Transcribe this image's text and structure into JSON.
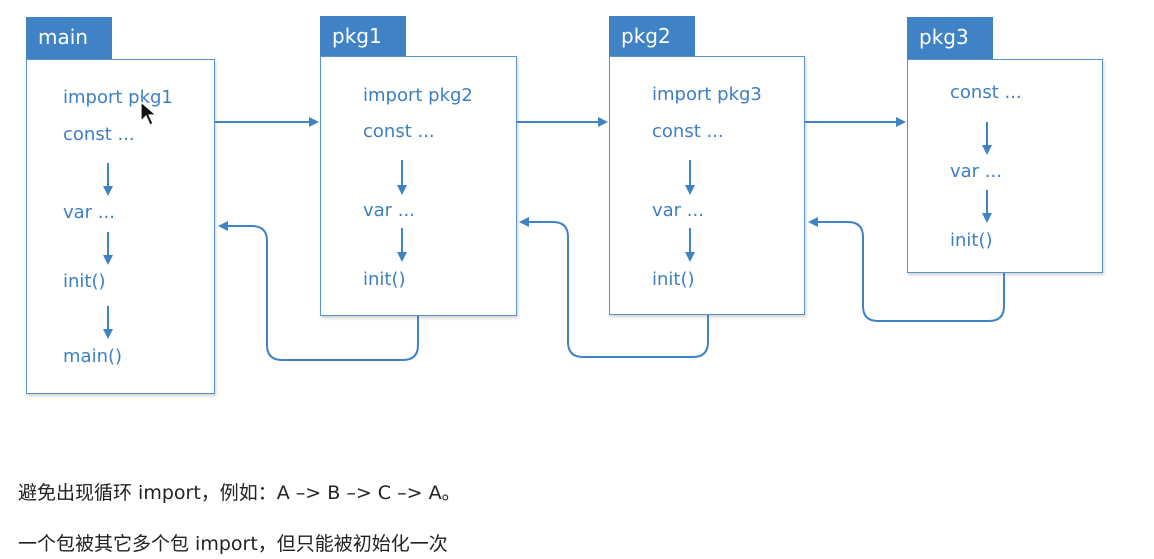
{
  "packages": [
    {
      "title": "main",
      "lines": {
        "import": "import pkg1",
        "const": "const ...",
        "var": "var ...",
        "init": "init()",
        "main": "main()"
      }
    },
    {
      "title": "pkg1",
      "lines": {
        "import": "import pkg2",
        "const": "const ...",
        "var": "var ...",
        "init": "init()"
      }
    },
    {
      "title": "pkg2",
      "lines": {
        "import": "import pkg3",
        "const": "const ...",
        "var": "var ...",
        "init": "init()"
      }
    },
    {
      "title": "pkg3",
      "lines": {
        "const": "const ...",
        "var": "var ...",
        "init": "init()"
      }
    }
  ],
  "notes": [
    "避免出现循环 import，例如：A –> B –> C –> A。",
    "一个包被其它多个包 import，但只能被初始化一次"
  ],
  "colors": {
    "tab": "#3f83c6",
    "text": "#3d7fc2",
    "arrow": "#3f83c6",
    "border": "#5a93cc"
  }
}
